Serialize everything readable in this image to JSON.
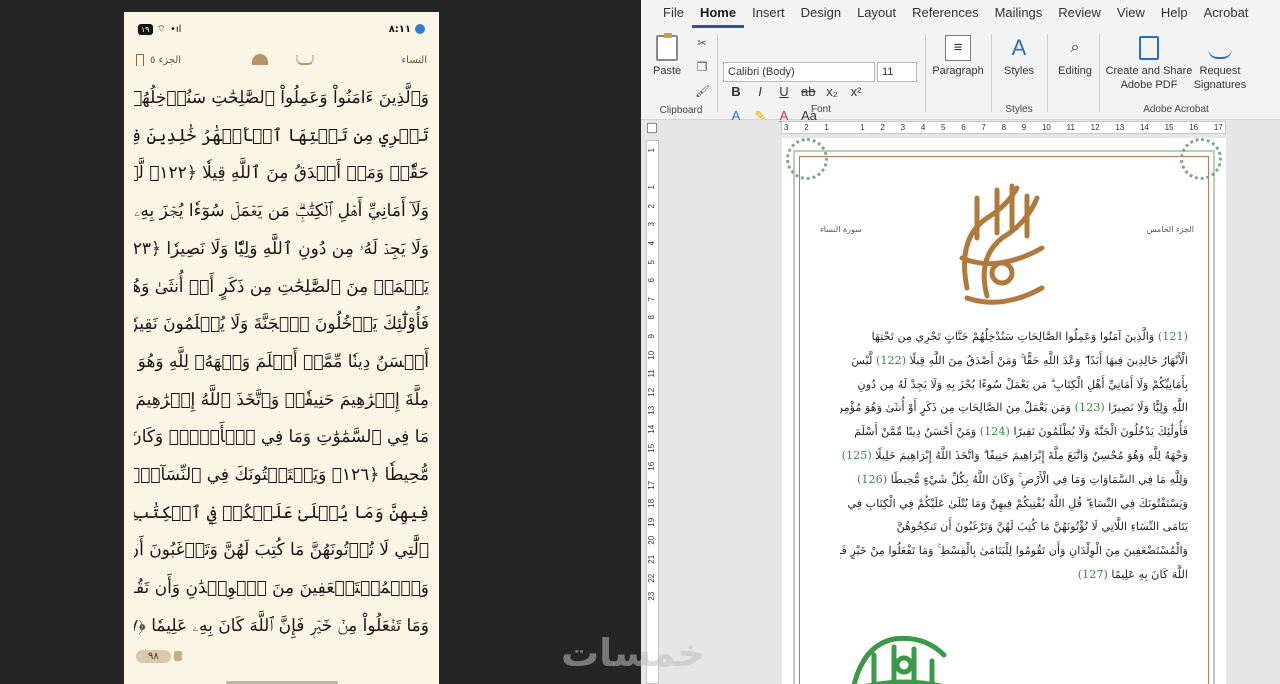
{
  "phone": {
    "status": {
      "battery": "١٩",
      "signal": "•ıl",
      "time": "٨:١١"
    },
    "header": {
      "surah": "النساء",
      "juz": "الجزء ٥"
    },
    "lines": [
      "وَٱلَّذِينَ ءَامَنُواْ وَعَمِلُواْ ٱلصَّٰلِحَٰتِ سَنُدۡخِلُهُمۡ جَنَّٰتٖ",
      "تَجۡرِي مِن تَحۡتِهَا ٱلۡأَنۡهَٰرُ خَٰلِدِينَ فِيهَآ أَبَدٗاۖ وَعۡدَ ٱللَّهِ",
      "حَقّٗاۚ وَمَنۡ أَصۡدَقُ مِنَ ٱللَّهِ قِيلٗا ﴿١٢٢﴾ لَّيۡسَ بِأَمَانِيِّكُمۡ",
      "وَلَآ أَمَانِيِّ أَهۡلِ ٱلۡكِتَٰبِۗ مَن يَعۡمَلۡ سُوٓءٗا يُجۡزَ بِهِۦ",
      "وَلَا يَجِدۡ لَهُۥ مِن دُونِ ٱللَّهِ وَلِيّٗا وَلَا نَصِيرٗا ﴿١٢٣﴾ وَمَن",
      "يَعۡمَلۡ مِنَ ٱلصَّٰلِحَٰتِ مِن ذَكَرٍ أَوۡ أُنثَىٰ وَهُوَ مُؤۡمِنٞ",
      "فَأُوْلَٰٓئِكَ يَدۡخُلُونَ ٱلۡجَنَّةَ وَلَا يُظۡلَمُونَ نَقِيرٗا ﴿١٢٤﴾ وَمَنۡ",
      "أَحۡسَنُ دِينٗا مِّمَّنۡ أَسۡلَمَ وَجۡهَهُۥ لِلَّهِ وَهُوَ مُحۡسِنٞ وَٱتَّبَعَ",
      "مِلَّةَ إِبۡرَٰهِيمَ حَنِيفٗاۗ وَٱتَّخَذَ ٱللَّهُ إِبۡرَٰهِيمَ خَلِيلٗا ﴿١٢٥﴾ وَلِلَّهِ",
      "مَا فِي ٱلسَّمَٰوَٰتِ وَمَا فِي ٱلۡأَرۡضِۚ وَكَانَ ٱللَّهُ بِكُلِّ شَيۡءٖ",
      "مُّحِيطٗا ﴿١٢٦﴾ وَيَسۡتَفۡتُونَكَ فِي ٱلنِّسَآءِۖ قُلِ ٱللَّهُ يُفۡتِيكُمۡ",
      "فِيهِنَّ وَمَا يُتۡلَىٰ عَلَيۡكُمۡ فِي ٱلۡكِتَٰبِ فِي يَتَٰمَى ٱلنِّسَآءِ",
      "ٱلَّٰتِي لَا تُؤۡتُونَهُنَّ مَا كُتِبَ لَهُنَّ وَتَرۡغَبُونَ أَن تَنكِحُوهُنَّ",
      "وَٱلۡمُسۡتَضۡعَفِينَ مِنَ ٱلۡوِلۡدَٰنِ وَأَن تَقُومُواْ لِلۡيَتَٰمَىٰ بِٱلۡقِسۡطِۚ",
      "وَمَا تَفۡعَلُواْ مِنۡ خَيۡرٖ فَإِنَّ ٱللَّهَ كَانَ بِهِۦ عَلِيمٗا ﴿١٢٧﴾"
    ],
    "page_number": "٩٨"
  },
  "word": {
    "menu": [
      "File",
      "Home",
      "Insert",
      "Design",
      "Layout",
      "References",
      "Mailings",
      "Review",
      "View",
      "Help",
      "Acrobat"
    ],
    "active_tab": "Home",
    "clipboard": {
      "paste": "Paste",
      "label": "Clipboard"
    },
    "font": {
      "name": "Calibri (Body)",
      "size": "11",
      "label": "Font"
    },
    "paragraph": {
      "label": "Paragraph"
    },
    "styles": {
      "btn": "Styles",
      "label": "Styles"
    },
    "editing": {
      "btn": "Editing"
    },
    "acrobat": {
      "create_line1": "Create and Share",
      "create_line2": "Adobe PDF",
      "request_line1": "Request",
      "request_line2": "Signatures",
      "label": "Adobe Acrobat"
    },
    "ruler_h": [
      "3",
      "2",
      "1",
      "",
      "1",
      "2",
      "3",
      "4",
      "5",
      "6",
      "7",
      "8",
      "9",
      "10",
      "11",
      "12",
      "13",
      "14",
      "15",
      "16",
      "17"
    ],
    "ruler_v": [
      "1",
      "",
      "1",
      "2",
      "3",
      "4",
      "5",
      "6",
      "7",
      "8",
      "9",
      "10",
      "11",
      "12",
      "13",
      "14",
      "15",
      "16",
      "17",
      "18",
      "19",
      "20",
      "21",
      "22",
      "23"
    ],
    "doc": {
      "juz_label": "الجزء الخامس",
      "surah_label": "سورة النساء",
      "lines": [
        "(121) وَالَّذِينَ آمَنُوا وَعَمِلُوا الصَّالِحَاتِ سَنُدْخِلُهُمْ جَنَّاتٍ تَجْرِي مِن تَحْتِهَا",
        "الْأَنْهَارُ خَالِدِينَ فِيهَا أَبَدًا ۖ وَعْدَ اللَّهِ حَقًّا ۚ وَمَنْ أَصْدَقُ مِنَ اللَّهِ قِيلًا (122) لَّيْسَ",
        "بِأَمَانِيِّكُمْ وَلَا أَمَانِيِّ أَهْلِ الْكِتَابِ ۗ مَن يَعْمَلْ سُوءًا يُجْزَ بِهِ وَلَا يَجِدْ لَهُ مِن دُونِ",
        "اللَّهِ وَلِيًّا وَلَا نَصِيرًا (123) وَمَن يَعْمَلْ مِنَ الصَّالِحَاتِ مِن ذَكَرٍ أَوْ أُنثَىٰ وَهُوَ مُؤْمِنٌ",
        "فَأُولَٰئِكَ يَدْخُلُونَ الْجَنَّةَ وَلَا يُظْلَمُونَ نَقِيرًا (124) وَمَنْ أَحْسَنُ دِينًا مِّمَّنْ أَسْلَمَ",
        "وَجْهَهُ لِلَّهِ وَهُوَ مُحْسِنٌ وَاتَّبَعَ مِلَّةَ إِبْرَاهِيمَ حَنِيفًا ۗ وَاتَّخَذَ اللَّهُ إِبْرَاهِيمَ خَلِيلًا (125)",
        "وَلِلَّهِ مَا فِي السَّمَاوَاتِ وَمَا فِي الْأَرْضِ ۚ وَكَانَ اللَّهُ بِكُلِّ شَيْءٍ مُّحِيطًا (126)",
        "وَيَسْتَفْتُونَكَ فِي النِّسَاءِ ۖ قُلِ اللَّهُ يُفْتِيكُمْ فِيهِنَّ وَمَا يُتْلَىٰ عَلَيْكُمْ فِي الْكِتَابِ فِي",
        "يَتَامَى النِّسَاءِ اللَّاتِي لَا تُؤْتُونَهُنَّ مَا كُتِبَ لَهُنَّ وَتَرْغَبُونَ أَن تَنكِحُوهُنَّ",
        "وَالْمُسْتَضْعَفِينَ مِنَ الْوِلْدَانِ وَأَن تَقُومُوا لِلْيَتَامَىٰ بِالْقِسْطِ ۚ وَمَا تَفْعَلُوا مِنْ خَيْرٍ فَإِنَّ",
        "اللَّهَ كَانَ بِهِ عَلِيمًا (127)"
      ]
    }
  },
  "watermark": "خمسات",
  "colors": {
    "phone_bg": "#fbf5e6",
    "word_accent": "#2b579a",
    "verse_green": "#3a8a4a",
    "allah_red": "#b5533a",
    "bismillah_brown": "#b07a3c",
    "frame_green": "#b9cfb8"
  }
}
